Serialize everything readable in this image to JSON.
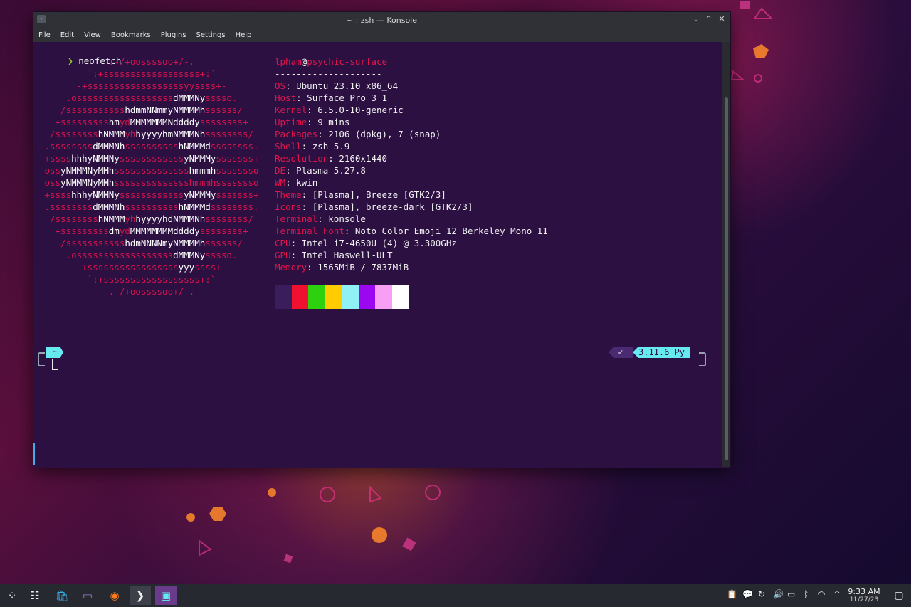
{
  "window": {
    "title": "~ : zsh — Konsole",
    "menu": [
      "File",
      "Edit",
      "View",
      "Bookmarks",
      "Plugins",
      "Settings",
      "Help"
    ],
    "buttons": {
      "minimize": "⌄",
      "maximize": "⌃",
      "close": "✕"
    }
  },
  "terminal": {
    "prompt_symbol": "❯",
    "command": "neofetch",
    "logo_lines": [
      [
        [
          ".-/+oossssoo+/-.",
          0
        ]
      ],
      [
        [
          "`:+ssssssssssssssssss+:`",
          0
        ]
      ],
      [
        [
          "-+ssssssssssssssssssyyssss+-",
          0
        ]
      ],
      [
        [
          ".ossssssssssssssssss",
          0
        ],
        [
          "dMMMNy",
          1
        ],
        [
          "sssso.",
          0
        ]
      ],
      [
        [
          "/sssssssssss",
          0
        ],
        [
          "hdmmNNmmyNMMMMh",
          1
        ],
        [
          "ssssss/",
          0
        ]
      ],
      [
        [
          "+sssssssss",
          0
        ],
        [
          "hm",
          1
        ],
        [
          "yd",
          0
        ],
        [
          "MMMMMMMNddddy",
          1
        ],
        [
          "ssssssss+",
          0
        ]
      ],
      [
        [
          "/ssssssss",
          0
        ],
        [
          "hNMMM",
          1
        ],
        [
          "yh",
          0
        ],
        [
          "hyyyyhmNMMMNh",
          1
        ],
        [
          "ssssssss/",
          0
        ]
      ],
      [
        [
          ".ssssssss",
          0
        ],
        [
          "dMMMNh",
          1
        ],
        [
          "ssssssssss",
          0
        ],
        [
          "hNMMMd",
          1
        ],
        [
          "ssssssss.",
          0
        ]
      ],
      [
        [
          "+ssss",
          0
        ],
        [
          "hhhyNMMNy",
          1
        ],
        [
          "ssssssssssss",
          0
        ],
        [
          "yNMMMy",
          1
        ],
        [
          "sssssss+",
          0
        ]
      ],
      [
        [
          "oss",
          0
        ],
        [
          "yNMMMNyMMh",
          1
        ],
        [
          "ssssssssssssss",
          0
        ],
        [
          "hmmmh",
          1
        ],
        [
          "ssssssso",
          0
        ]
      ],
      [
        [
          "oss",
          0
        ],
        [
          "yNMMMNyMMh",
          1
        ],
        [
          "sssssssssssssshmmmhssssssso",
          0
        ]
      ],
      [
        [
          "+ssss",
          0
        ],
        [
          "hhhyNMMNy",
          1
        ],
        [
          "ssssssssssss",
          0
        ],
        [
          "yNMMMy",
          1
        ],
        [
          "sssssss+",
          0
        ]
      ],
      [
        [
          ".ssssssss",
          0
        ],
        [
          "dMMMNh",
          1
        ],
        [
          "ssssssssss",
          0
        ],
        [
          "hNMMMd",
          1
        ],
        [
          "ssssssss.",
          0
        ]
      ],
      [
        [
          "/ssssssss",
          0
        ],
        [
          "hNMMM",
          1
        ],
        [
          "yh",
          0
        ],
        [
          "hyyyyhdNMMMNh",
          1
        ],
        [
          "ssssssss/",
          0
        ]
      ],
      [
        [
          "+sssssssss",
          0
        ],
        [
          "dm",
          1
        ],
        [
          "yd",
          0
        ],
        [
          "MMMMMMMMddddy",
          1
        ],
        [
          "ssssssss+",
          0
        ]
      ],
      [
        [
          "/sssssssssss",
          0
        ],
        [
          "hdmNNNNmyNMMMMh",
          1
        ],
        [
          "ssssss/",
          0
        ]
      ],
      [
        [
          ".ossssssssssssssssss",
          0
        ],
        [
          "dMMMNy",
          1
        ],
        [
          "sssso.",
          0
        ]
      ],
      [
        [
          "-+sssssssssssssssss",
          0
        ],
        [
          "yyy",
          1
        ],
        [
          "ssss+-",
          0
        ]
      ],
      [
        [
          "`:+ssssssssssssssssss+:`",
          0
        ]
      ],
      [
        [
          ".-/+oossssoo+/-.",
          0
        ]
      ]
    ],
    "user": "lpham",
    "at": "@",
    "host": "psychic-surface",
    "separator": "--------------------",
    "info": [
      {
        "key": "OS",
        "value": "Ubuntu 23.10 x86_64"
      },
      {
        "key": "Host",
        "value": "Surface Pro 3 1"
      },
      {
        "key": "Kernel",
        "value": "6.5.0-10-generic"
      },
      {
        "key": "Uptime",
        "value": "9 mins"
      },
      {
        "key": "Packages",
        "value": "2106 (dpkg), 7 (snap)"
      },
      {
        "key": "Shell",
        "value": "zsh 5.9"
      },
      {
        "key": "Resolution",
        "value": "2160x1440"
      },
      {
        "key": "DE",
        "value": "Plasma 5.27.8"
      },
      {
        "key": "WM",
        "value": "kwin"
      },
      {
        "key": "Theme",
        "value": "[Plasma], Breeze [GTK2/3]"
      },
      {
        "key": "Icons",
        "value": "[Plasma], breeze-dark [GTK2/3]"
      },
      {
        "key": "Terminal",
        "value": "konsole"
      },
      {
        "key": "Terminal Font",
        "value": "Noto Color Emoji 12 Berkeley Mono 11"
      },
      {
        "key": "CPU",
        "value": "Intel i7-4650U (4) @ 3.300GHz"
      },
      {
        "key": "GPU",
        "value": "Intel Haswell-ULT"
      },
      {
        "key": "Memory",
        "value": "1565MiB / 7837MiB"
      }
    ],
    "palette_colors": [
      "#3a1e5c",
      "#f0102f",
      "#2ed10e",
      "#ffcc00",
      "#8ff0f5",
      "#9a08f0",
      "#f79ef5",
      "#ffffff"
    ],
    "home_segment": "~",
    "right_prompt_check": "✔",
    "python_version": "3.11.6 Py"
  },
  "taskbar": {
    "launcher_icon": "plasma-launcher-icon",
    "apps": [
      {
        "name": "system-settings-icon",
        "glyph": "☷"
      },
      {
        "name": "discover-store-icon",
        "glyph": "🛍"
      },
      {
        "name": "file-manager-icon",
        "glyph": "▭"
      },
      {
        "name": "firefox-icon",
        "glyph": "◉"
      },
      {
        "name": "konsole-icon",
        "glyph": "❯"
      },
      {
        "name": "screenshot-app-icon",
        "glyph": "▣"
      }
    ],
    "tray": [
      {
        "name": "clipboard-icon",
        "glyph": "📋"
      },
      {
        "name": "notifications-icon",
        "glyph": "💬"
      },
      {
        "name": "updates-icon",
        "glyph": "↻"
      },
      {
        "name": "volume-icon",
        "glyph": "🔊"
      },
      {
        "name": "battery-icon",
        "glyph": "▭"
      },
      {
        "name": "bluetooth-icon",
        "glyph": "ᛒ"
      },
      {
        "name": "wifi-icon",
        "glyph": "◠"
      },
      {
        "name": "tray-expand-icon",
        "glyph": "^"
      }
    ],
    "time": "9:33 AM",
    "date": "11/27/23",
    "show_desktop_glyph": "▢"
  },
  "colors": {
    "accent": "#66e9ef",
    "red": "#e1154c",
    "terminal_bg": "#2c1042"
  }
}
